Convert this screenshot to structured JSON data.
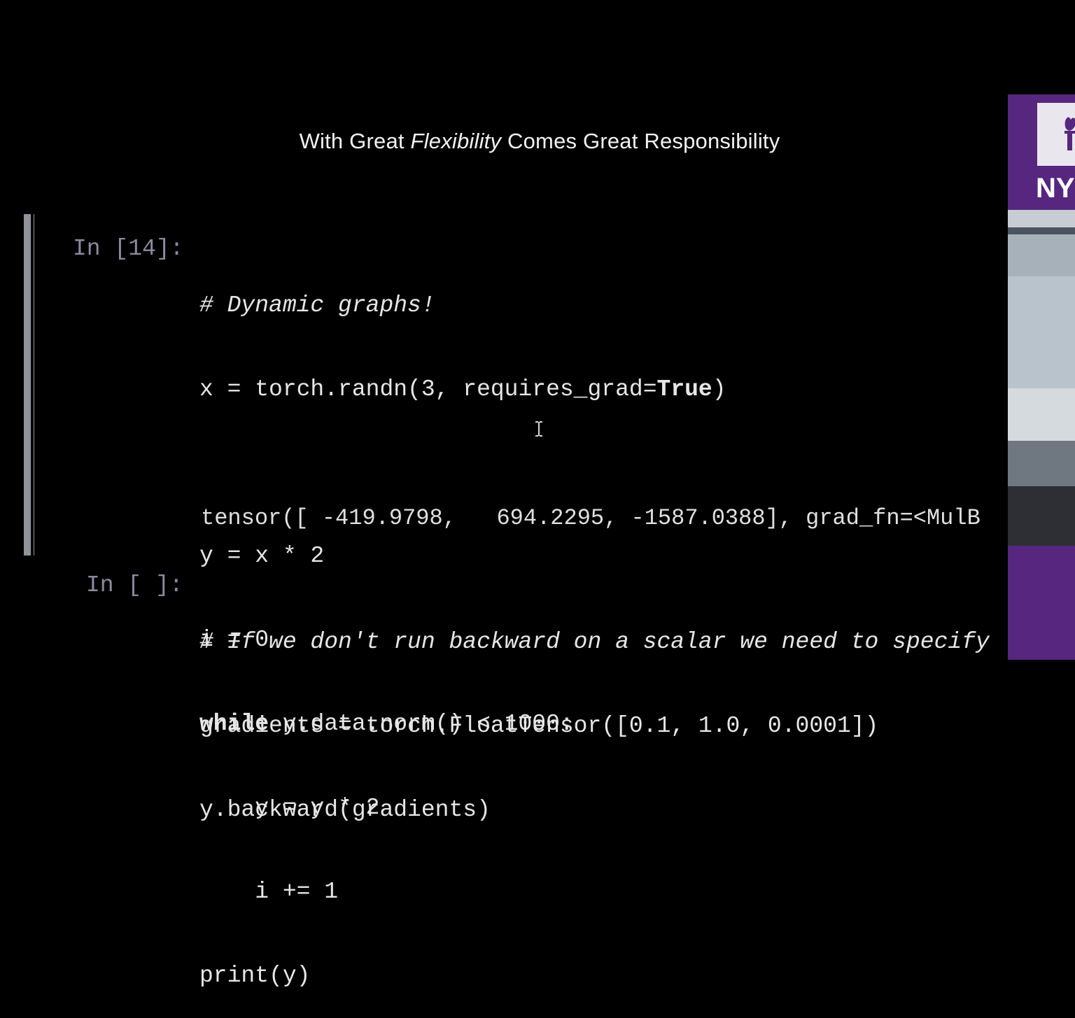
{
  "slide": {
    "title_pre": "With Great ",
    "title_em": "Flexibility",
    "title_post": " Comes Great Responsibility"
  },
  "cell1": {
    "prompt": "In [14]:",
    "lines": [
      "# Dynamic graphs!",
      "x = torch.randn(3, requires_grad=True)",
      "",
      "y = x * 2",
      "i = 0",
      "while y.data.norm() < 1000:",
      "    y = y * 2",
      "    i += 1",
      "print(y)"
    ],
    "output": "tensor([ -419.9798,   694.2295, -1587.0388], grad_fn=<MulB"
  },
  "cell2": {
    "prompt": "In [ ]:",
    "lines": [
      "# If we don't run backward on a scalar we need to specify",
      "gradients = torch.FloatTensor([0.1, 1.0, 0.0001])",
      "y.backward(gradients)"
    ]
  },
  "side_panel": {
    "logo_text": "NY",
    "brand_color": "#57267f"
  },
  "icons": {
    "cursor": "text-cursor-icon",
    "logo": "torch-logo-icon"
  }
}
